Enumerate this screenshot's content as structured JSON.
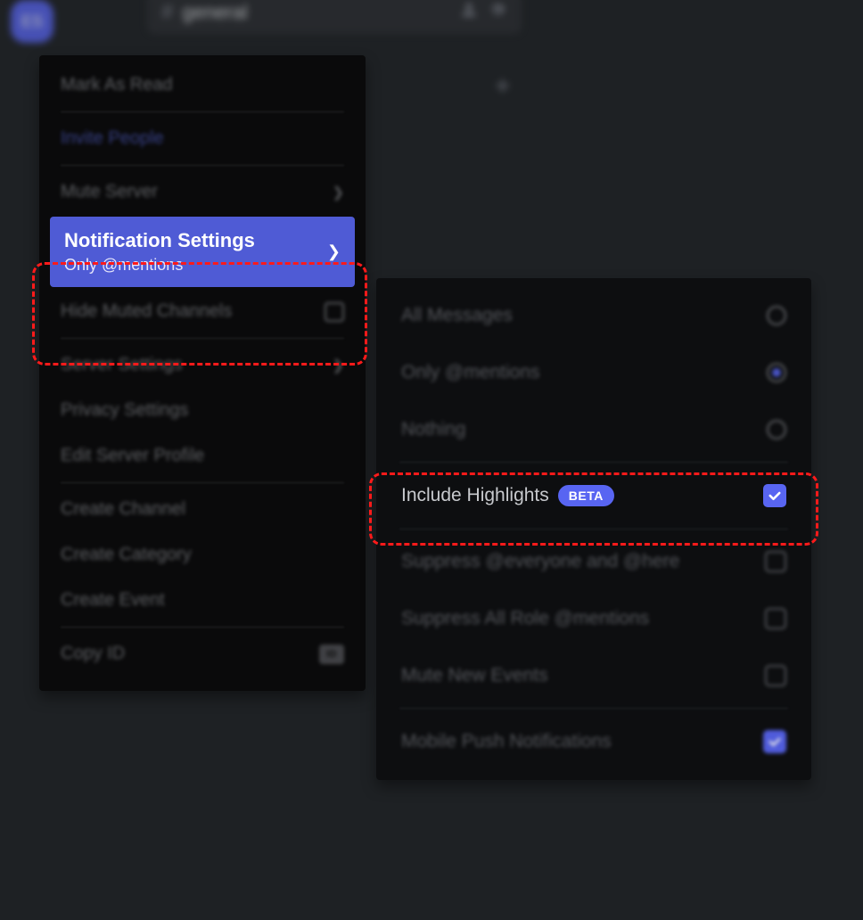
{
  "server": {
    "initials": "ES"
  },
  "channel": {
    "name": "general"
  },
  "contextMenu": {
    "markAsRead": "Mark As Read",
    "invitePeople": "Invite People",
    "muteServer": "Mute Server",
    "notificationSettings": {
      "title": "Notification Settings",
      "subtitle": "Only @mentions"
    },
    "hideMutedChannels": "Hide Muted Channels",
    "serverSettings": "Server Settings",
    "privacySettings": "Privacy Settings",
    "editServerProfile": "Edit Server Profile",
    "createChannel": "Create Channel",
    "createCategory": "Create Category",
    "createEvent": "Create Event",
    "copyId": "Copy ID",
    "idBadge": "ID"
  },
  "submenu": {
    "allMessages": "All Messages",
    "onlyMentions": "Only @mentions",
    "nothing": "Nothing",
    "includeHighlights": "Include Highlights",
    "betaLabel": "BETA",
    "suppressEveryone": "Suppress @everyone and @here",
    "suppressRoles": "Suppress All Role @mentions",
    "muteNewEvents": "Mute New Events",
    "mobilePush": "Mobile Push Notifications"
  }
}
